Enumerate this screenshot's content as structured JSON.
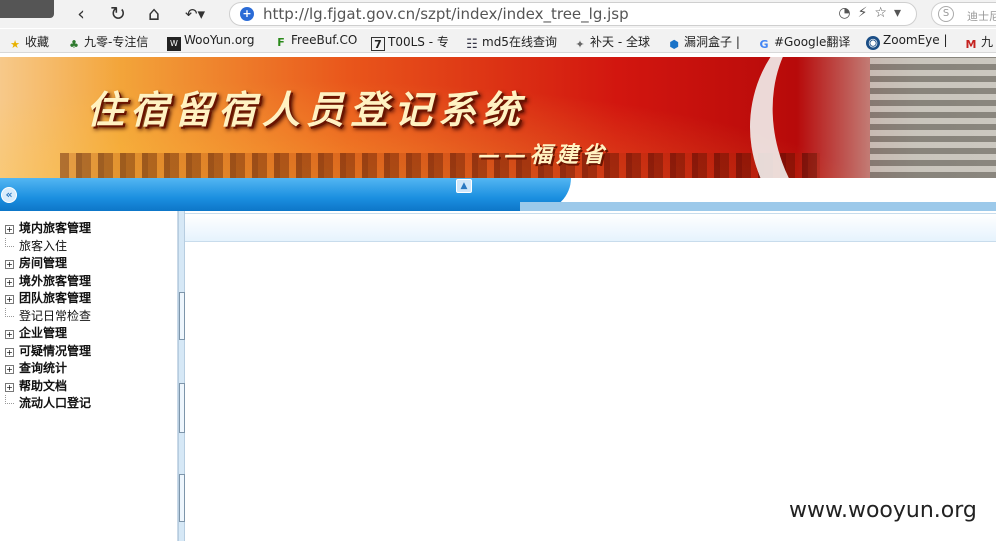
{
  "browser": {
    "url": "http://lg.fjgat.gov.cn/szpt/index/index_tree_lg.jsp",
    "search_placeholder": "迪士尼",
    "bookmarks": [
      {
        "label": "收藏",
        "icon": "star-icon"
      },
      {
        "label": "九零-专注信",
        "icon": "leaf-icon"
      },
      {
        "label": "WooYun.org",
        "icon": "wooyun-icon"
      },
      {
        "label": "FreeBuf.CO",
        "icon": "freebuf-icon"
      },
      {
        "label": "T00LS - 专",
        "icon": "t00ls-icon"
      },
      {
        "label": "md5在线查询",
        "icon": "grid-icon"
      },
      {
        "label": "补天 - 全球",
        "icon": "butian-icon"
      },
      {
        "label": "漏洞盒子 |",
        "icon": "hexagon-icon"
      },
      {
        "label": "#Google翻译",
        "icon": "google-translate-icon"
      },
      {
        "label": "ZoomEye |",
        "icon": "eye-icon"
      },
      {
        "label": "九",
        "icon": "mail-icon"
      }
    ]
  },
  "banner": {
    "title": "住宿留宿人员登记系统",
    "subtitle": "——福建省"
  },
  "sidebar": {
    "items": [
      {
        "label": "境内旅客管理",
        "expandable": true
      },
      {
        "label": "旅客入住",
        "expandable": false
      },
      {
        "label": "房间管理",
        "expandable": true
      },
      {
        "label": "境外旅客管理",
        "expandable": true
      },
      {
        "label": "团队旅客管理",
        "expandable": true
      },
      {
        "label": "登记日常检查",
        "expandable": false
      },
      {
        "label": "企业管理",
        "expandable": true
      },
      {
        "label": "可疑情况管理",
        "expandable": true
      },
      {
        "label": "查询统计",
        "expandable": true
      },
      {
        "label": "帮助文档",
        "expandable": true
      },
      {
        "label": "流动人口登记",
        "expandable": false
      }
    ]
  },
  "watermark": "www.wooyun.org"
}
